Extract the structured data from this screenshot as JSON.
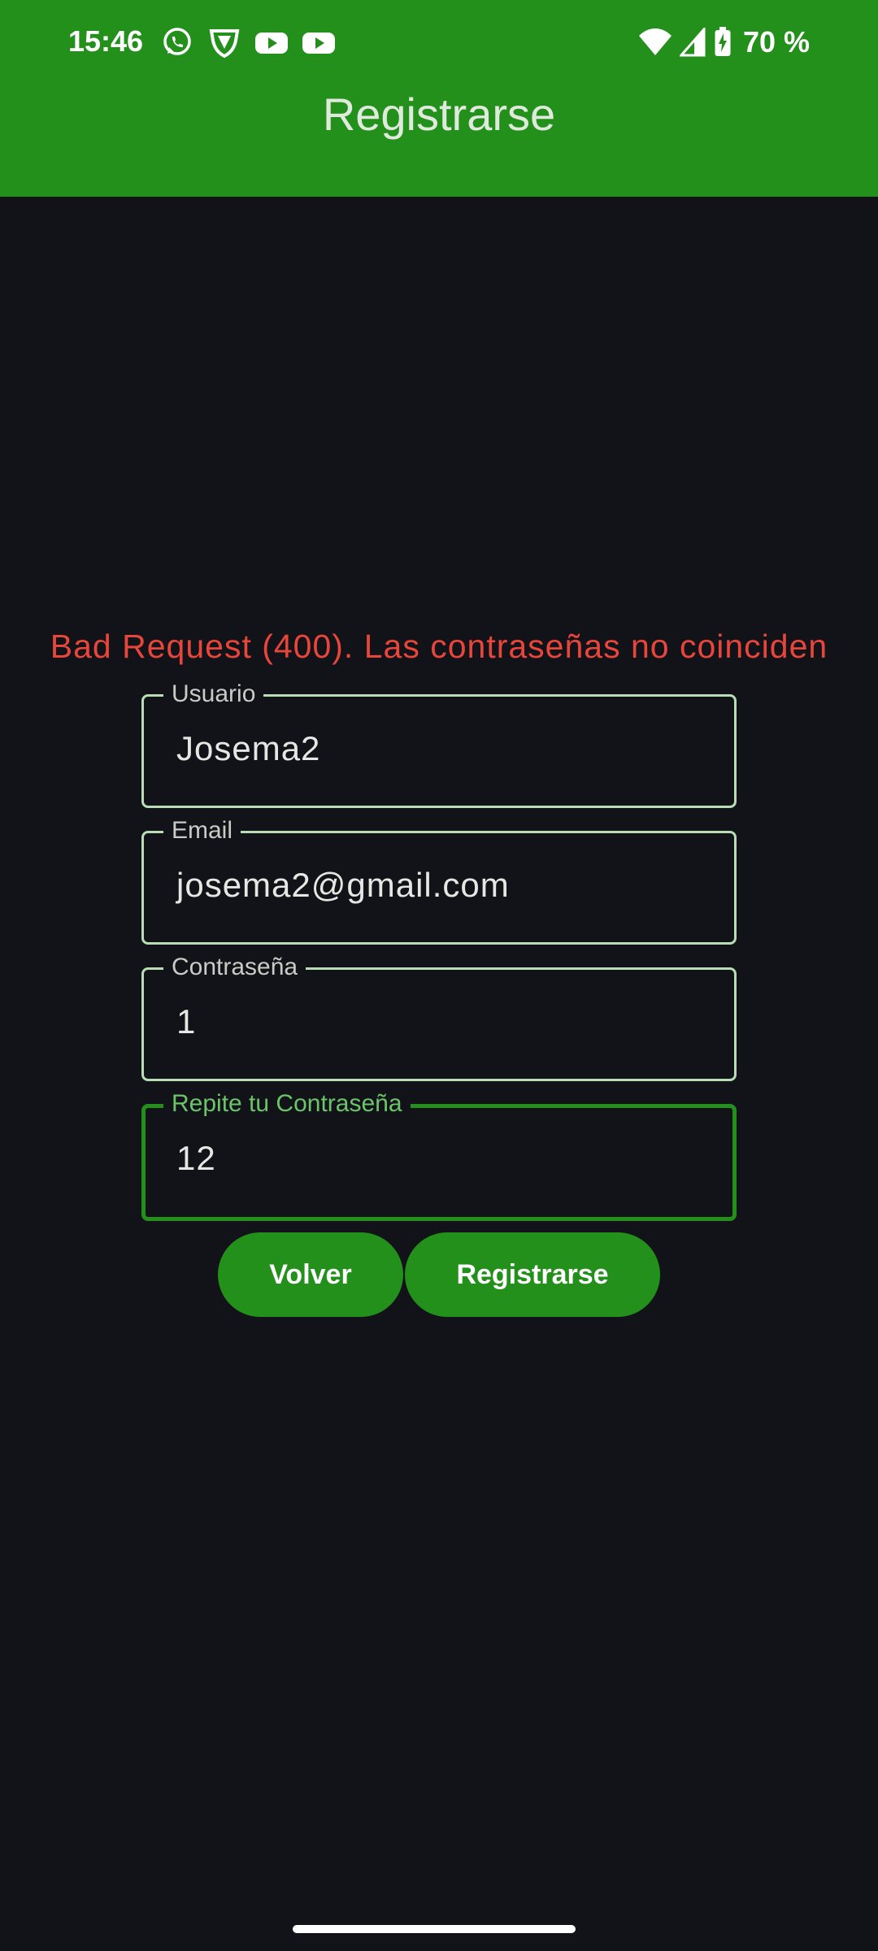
{
  "status_bar": {
    "time": "15:46",
    "notification_icons": [
      "whatsapp-icon",
      "vpn-shield-icon",
      "youtube-icon",
      "youtube-icon"
    ],
    "battery_percent": "70 %"
  },
  "app_bar": {
    "title": "Registrarse",
    "background_color": "#23901c"
  },
  "error_message": "Bad Request (400). Las contraseñas no coinciden",
  "form": {
    "username": {
      "label": "Usuario",
      "value": "Josema2"
    },
    "email": {
      "label": "Email",
      "value": "josema2@gmail.com"
    },
    "password": {
      "label": "Contraseña",
      "value": "1"
    },
    "repeat_password": {
      "label": "Repite tu Contraseña",
      "value": "12"
    }
  },
  "buttons": {
    "back_label": "Volver",
    "register_label": "Registrarse"
  },
  "colors": {
    "accent": "#23901c",
    "error": "#e8453b",
    "background": "#121318"
  }
}
